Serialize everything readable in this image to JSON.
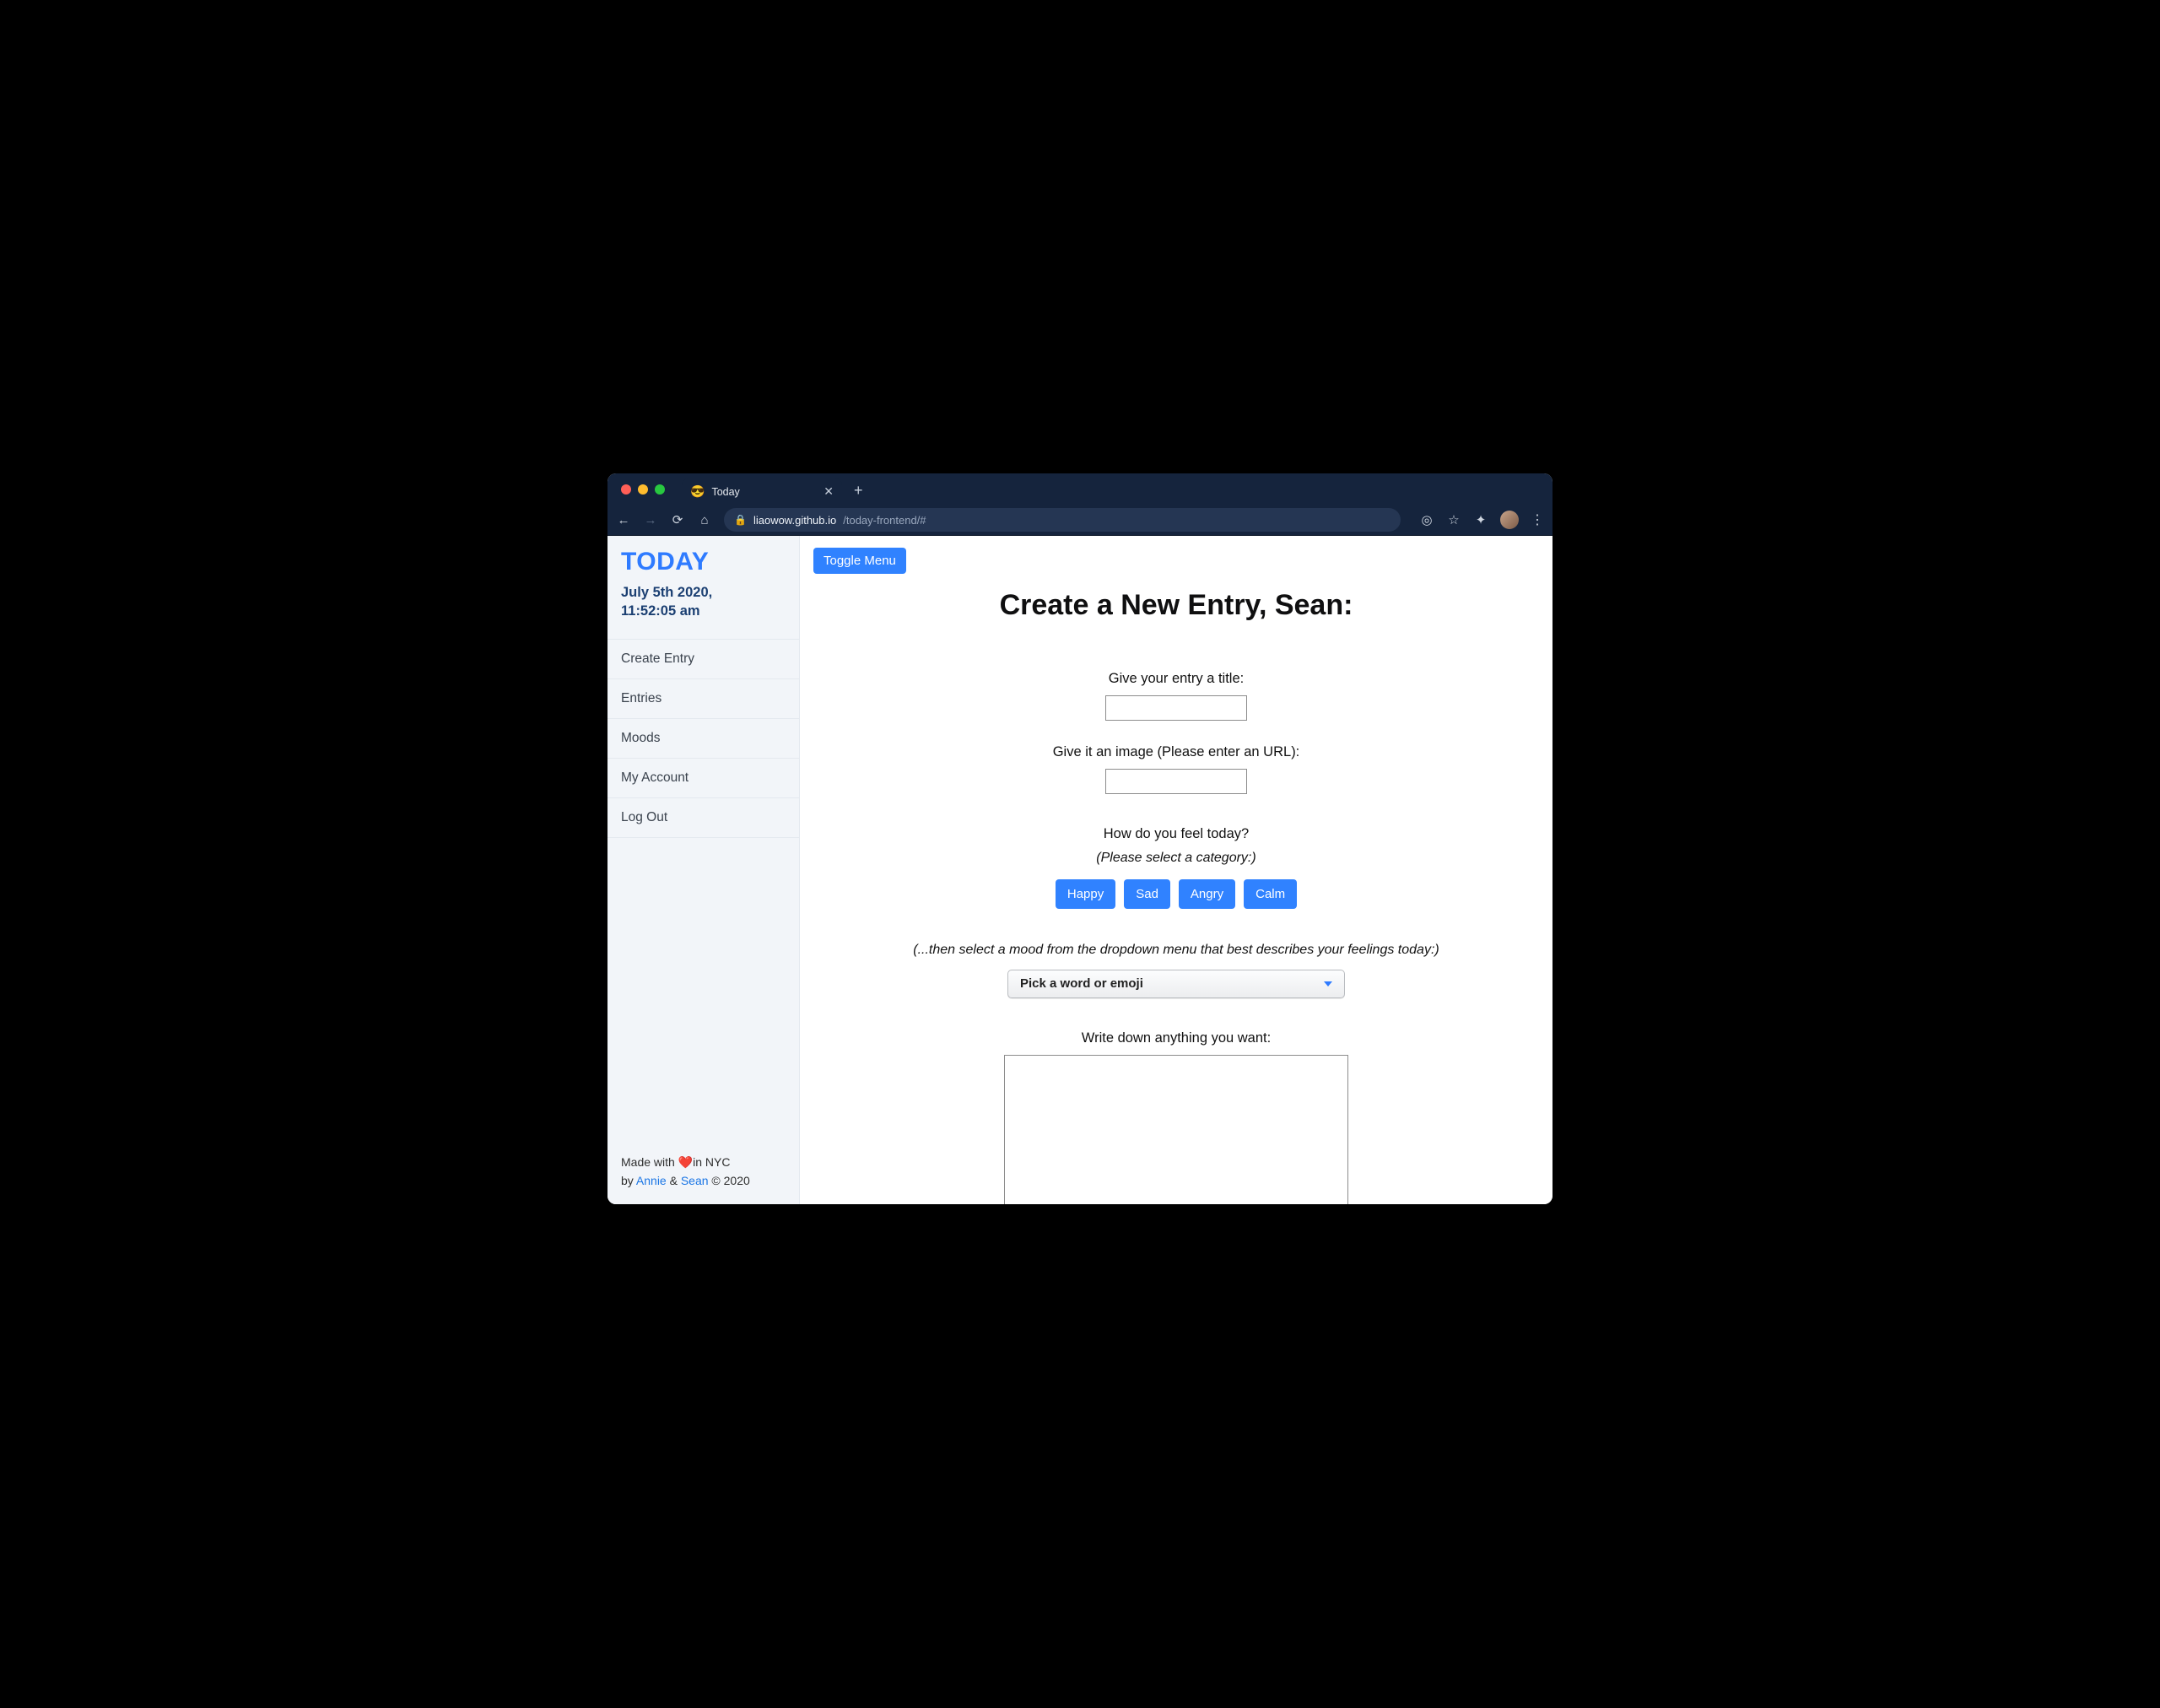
{
  "browser": {
    "tab": {
      "favicon": "😎",
      "title": "Today"
    },
    "url": {
      "host": "liaowow.github.io",
      "path": "/today-frontend/#"
    }
  },
  "sidebar": {
    "brand": "TODAY",
    "dateLine1": "July 5th 2020,",
    "dateLine2": "11:52:05 am",
    "items": [
      {
        "label": "Create Entry"
      },
      {
        "label": "Entries"
      },
      {
        "label": "Moods"
      },
      {
        "label": "My Account"
      },
      {
        "label": "Log Out"
      }
    ],
    "footer": {
      "line1_prefix": "Made with ",
      "heart": "❤️",
      "line1_suffix": "in NYC",
      "line2_prefix": "by ",
      "author1": "Annie",
      "amp": " & ",
      "author2": "Sean",
      "line2_suffix": " © 2020"
    }
  },
  "main": {
    "toggle": "Toggle Menu",
    "heading": "Create a New Entry, Sean:",
    "titleLabel": "Give your entry a title:",
    "titleValue": "",
    "imageLabel": "Give it an image (Please enter an URL):",
    "imageValue": "",
    "moodLabel": "How do you feel today?",
    "moodSub": "(Please select a category:)",
    "moods": [
      "Happy",
      "Sad",
      "Angry",
      "Calm"
    ],
    "dropdownHint": "(...then select a mood from the dropdown menu that best describes your feelings today:)",
    "dropdownSelected": "Pick a word or emoji",
    "writeLabel": "Write down anything you want:",
    "writeValue": ""
  }
}
